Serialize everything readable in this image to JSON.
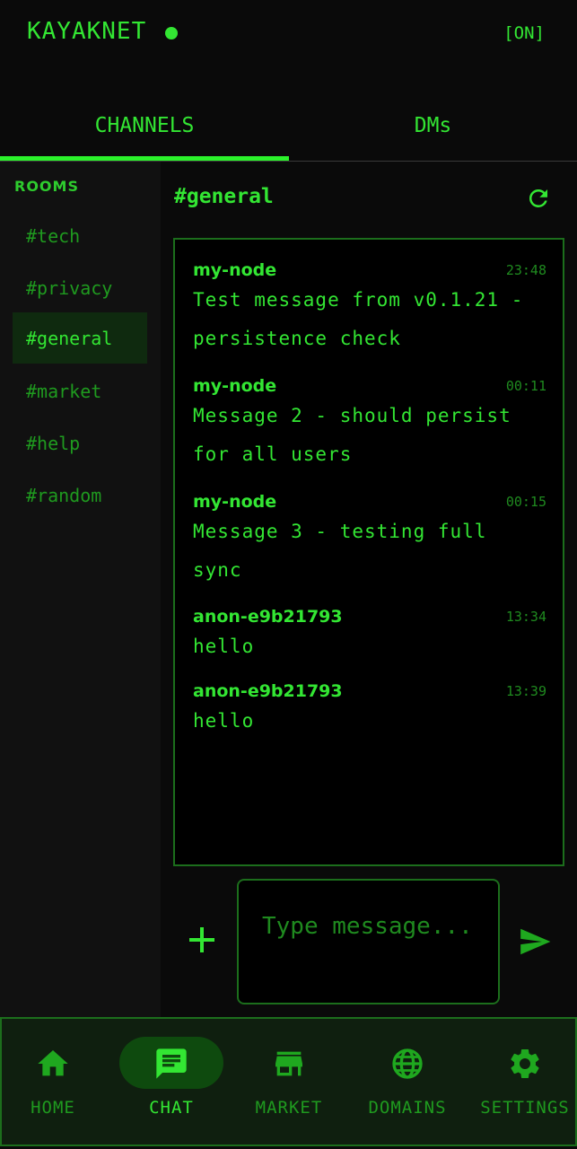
{
  "app": {
    "title": "KAYAKNET",
    "status": "[ON]"
  },
  "tabs": [
    {
      "label": "CHANNELS",
      "active": true
    },
    {
      "label": "DMs",
      "active": false
    }
  ],
  "sidebar": {
    "heading": "ROOMS",
    "rooms": [
      "#tech",
      "#privacy",
      "#general",
      "#market",
      "#help",
      "#random"
    ],
    "active_room": "#general"
  },
  "chat": {
    "channel": "#general",
    "messages": [
      {
        "author": "my-node",
        "time": "23:48",
        "text": "Test message from v0.1.21 - persistence check"
      },
      {
        "author": "my-node",
        "time": "00:11",
        "text": "Message 2 - should persist for all users"
      },
      {
        "author": "my-node",
        "time": "00:15",
        "text": "Message 3 - testing full sync"
      },
      {
        "author": "anon-e9b21793",
        "time": "13:34",
        "text": "hello"
      },
      {
        "author": "anon-e9b21793",
        "time": "13:39",
        "text": "hello"
      }
    ]
  },
  "composer": {
    "placeholder": "Type message..."
  },
  "nav": [
    {
      "label": "HOME",
      "icon": "home-icon",
      "active": false
    },
    {
      "label": "CHAT",
      "icon": "chat-icon",
      "active": true
    },
    {
      "label": "MARKET",
      "icon": "store-icon",
      "active": false
    },
    {
      "label": "DOMAINS",
      "icon": "globe-icon",
      "active": false
    },
    {
      "label": "SETTINGS",
      "icon": "gear-icon",
      "active": false
    }
  ],
  "colors": {
    "accent": "#33e633",
    "dim": "#1f9a1f",
    "background": "#0a0a0a",
    "border": "#1c6e1c"
  }
}
